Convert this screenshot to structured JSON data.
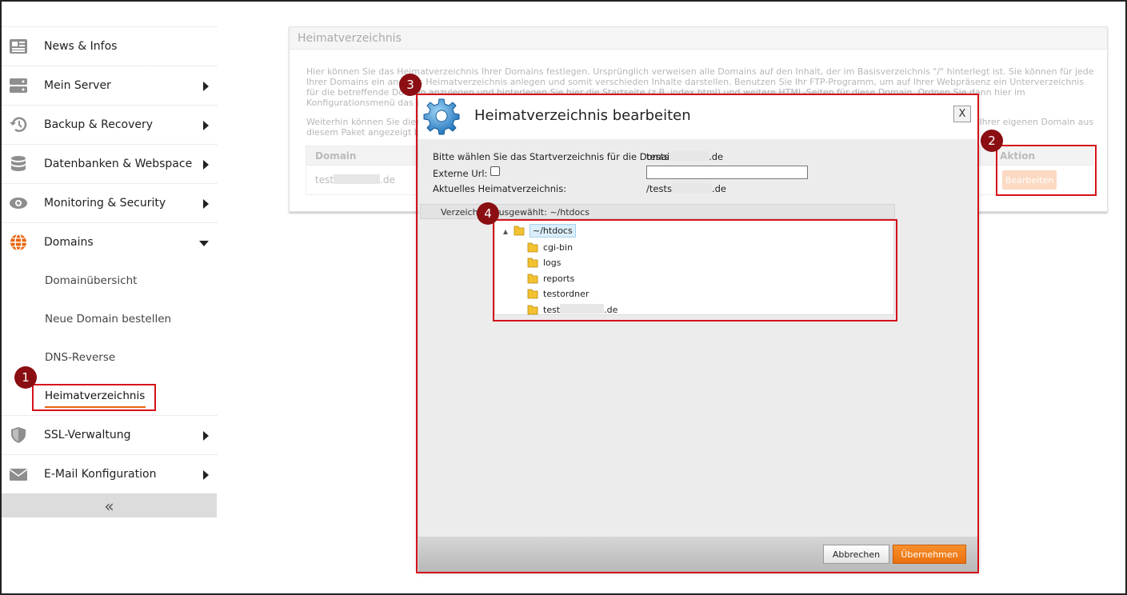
{
  "sidebar": {
    "items": [
      {
        "label": "News & Infos",
        "icon": "newspaper-icon"
      },
      {
        "label": "Mein Server",
        "icon": "server-icon"
      },
      {
        "label": "Backup & Recovery",
        "icon": "history-icon"
      },
      {
        "label": "Datenbanken & Webspace",
        "icon": "database-icon"
      },
      {
        "label": "Monitoring & Security",
        "icon": "eye-icon"
      },
      {
        "label": "Domains",
        "icon": "globe-icon"
      },
      {
        "label": "SSL-Verwaltung",
        "icon": "shield-icon"
      },
      {
        "label": "E-Mail Konfiguration",
        "icon": "envelope-icon"
      }
    ],
    "domain_subitems": [
      "Domainübersicht",
      "Neue Domain bestellen",
      "DNS-Reverse",
      "Heimatverzeichnis"
    ],
    "collapse_symbol": "«",
    "accent_color": "#e8640c"
  },
  "badges": [
    "1",
    "2",
    "3",
    "4"
  ],
  "panel": {
    "title": "Heimatverzeichnis",
    "text1": "Hier können Sie das Heimatverzeichnis Ihrer Domains festlegen. Ursprünglich verweisen alle Domains auf den Inhalt, der im Basisverzeichnis \"/\" hinterlegt ist. Sie können für jede Ihrer Domains ein anderes Heimatverzeichnis anlegen und somit verschieden Inhalte darstellen. Benutzen Sie Ihr FTP-Programm, um auf Ihrer Webpräsenz ein Unterverzeichnis für die betreffende Domain anzulegen und hinterlegen Sie hier die Startseite (z.B. index.html) und weitere HTML-Seiten für diese Domain. Ordnen Sie dann hier im Konfigurationsmenü das entsprechende Verzeichnis der Domain zu.",
    "text2": "Weiterhin können Sie diese Funktion nutzen, wenn Sie die Inhalte einer externen Webseite, die nicht bei uns gehostet wird, unter einer Subdomain oder Ihrer eigenen Domain aus diesem Paket angezeigt bekommen möchten.",
    "col_domain": "Domain",
    "col_action": "Aktion",
    "row_domain_prefix": "test",
    "row_domain_suffix": ".de",
    "edit_button": "Bearbeiten"
  },
  "modal": {
    "title": "Heimatverzeichnis bearbeiten",
    "close": "X",
    "label_start": "Bitte wählen Sie das Startverzeichnis für die Domain:",
    "start_prefix": "tests",
    "start_suffix": ".de",
    "label_external": "Externe Url:",
    "label_current": "Aktuelles Heimatverzeichnis:",
    "current_prefix": "/tests",
    "current_suffix": ".de",
    "tree_caption_label": "Verzeichnis ausgewählt:",
    "tree_caption_value": "~/htdocs",
    "tree_root": "~/htdocs",
    "tree_children": [
      "cgi-bin",
      "logs",
      "reports",
      "testordner"
    ],
    "tree_last_prefix": "test",
    "tree_last_suffix": ".de",
    "cancel_button": "Abbrechen",
    "apply_button": "Übernehmen"
  }
}
